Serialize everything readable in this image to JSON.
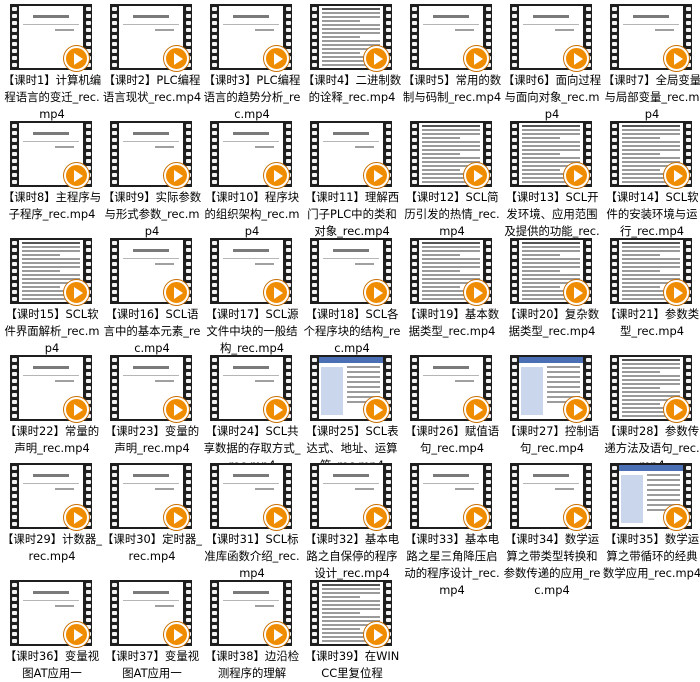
{
  "files": [
    {
      "label": "【课时1】计算机编程语言的变迁_rec.mp4",
      "thumb": "slide"
    },
    {
      "label": "【课时2】PLC编程语言现状_rec.mp4",
      "thumb": "slide"
    },
    {
      "label": "【课时3】PLC编程语言的趋势分析_rec.mp4",
      "thumb": "slide"
    },
    {
      "label": "【课时4】二进制数的诠释_rec.mp4",
      "thumb": "text"
    },
    {
      "label": "【课时5】常用的数制与码制_rec.mp4",
      "thumb": "slide"
    },
    {
      "label": "【课时6】面向过程与面向对象_rec.mp4",
      "thumb": "slide"
    },
    {
      "label": "【课时7】全局变量与局部变量_rec.mp4",
      "thumb": "slide"
    },
    {
      "label": "【课时8】主程序与子程序_rec.mp4",
      "thumb": "slide"
    },
    {
      "label": "【课时9】实际参数与形式参数_rec.mp4",
      "thumb": "slide"
    },
    {
      "label": "【课时10】程序块的组织架构_rec.mp4",
      "thumb": "slide"
    },
    {
      "label": "【课时11】理解西门子PLC中的类和对象_rec.mp4",
      "thumb": "slide"
    },
    {
      "label": "【课时12】SCL简历引发的热情_rec.mp4",
      "thumb": "text"
    },
    {
      "label": "【课时13】SCL开发环境、应用范围及提供的功能_rec.mp4",
      "thumb": "text"
    },
    {
      "label": "【课时14】SCL软件的安装环境与运行_rec.mp4",
      "thumb": "text"
    },
    {
      "label": "【课时15】SCL软件界面解析_rec.mp4",
      "thumb": "text"
    },
    {
      "label": "【课时16】SCL语言中的基本元素_rec.mp4",
      "thumb": "slide"
    },
    {
      "label": "【课时17】SCL源文件中块的一般结构_rec.mp4",
      "thumb": "slide"
    },
    {
      "label": "【课时18】SCL各个程序块的结构_rec.mp4",
      "thumb": "slide"
    },
    {
      "label": "【课时19】基本数据类型_rec.mp4",
      "thumb": "text"
    },
    {
      "label": "【课时20】复杂数据类型_rec.mp4",
      "thumb": "text"
    },
    {
      "label": "【课时21】参数类型_rec.mp4",
      "thumb": "text"
    },
    {
      "label": "【课时22】常量的声明_rec.mp4",
      "thumb": "slide"
    },
    {
      "label": "【课时23】变量的声明_rec.mp4",
      "thumb": "slide"
    },
    {
      "label": "【课时24】SCL共享数据的存取方式_rec.mp4",
      "thumb": "slide"
    },
    {
      "label": "【课时25】SCL表达式、地址、运算符_rec.mp4",
      "thumb": "win"
    },
    {
      "label": "【课时26】赋值语句_rec.mp4",
      "thumb": "slide"
    },
    {
      "label": "【课时27】控制语句_rec.mp4",
      "thumb": "win"
    },
    {
      "label": "【课时28】参数传递方法及语句_rec.mp4",
      "thumb": "text"
    },
    {
      "label": "【课时29】计数器_rec.mp4",
      "thumb": "slide"
    },
    {
      "label": "【课时30】定时器_rec.mp4",
      "thumb": "slide"
    },
    {
      "label": "【课时31】SCL标准库函数介绍_rec.mp4",
      "thumb": "slide"
    },
    {
      "label": "【课时32】基本电路之自保停的程序设计_rec.mp4",
      "thumb": "slide"
    },
    {
      "label": "【课时33】基本电路之星三角降压启动的程序设计_rec.mp4",
      "thumb": "slide"
    },
    {
      "label": "【课时34】数学运算之带类型转换和参数传递的应用_rec.mp4",
      "thumb": "slide"
    },
    {
      "label": "【课时35】数学运算之带循环的经典数学应用_rec.mp4",
      "thumb": "win"
    },
    {
      "label": "【课时36】变量视图AT应用一",
      "thumb": "slide"
    },
    {
      "label": "【课时37】变量视图AT应用一",
      "thumb": "slide"
    },
    {
      "label": "【课时38】边沿检测程序的理解",
      "thumb": "slide"
    },
    {
      "label": "【课时39】在WINCC里复位程",
      "thumb": "text"
    }
  ]
}
